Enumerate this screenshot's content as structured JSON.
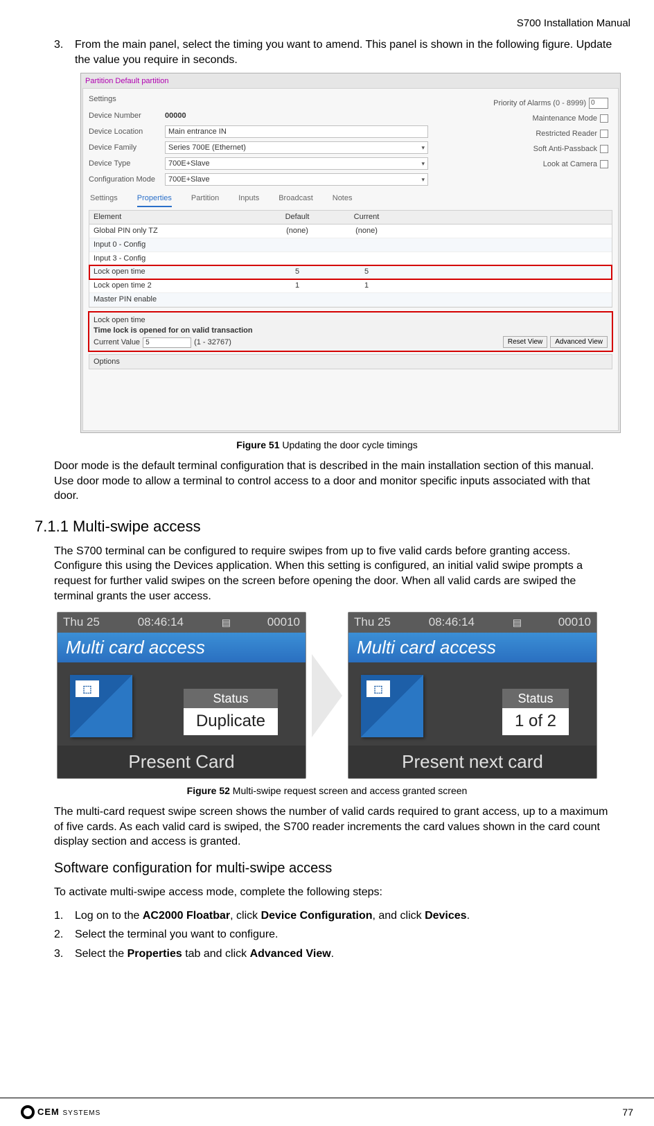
{
  "header": {
    "doc_title": "S700 Installation Manual"
  },
  "step3_text": "From the main panel, select the timing you want to amend. This panel is shown in the following figure. Update the value you require in seconds.",
  "fig51": {
    "window_title": "Partition  Default partition",
    "group_label": "Settings",
    "rows": {
      "device_number_lbl": "Device Number",
      "device_number_val": "00000",
      "device_location_lbl": "Device Location",
      "device_location_val": "Main entrance IN",
      "device_family_lbl": "Device Family",
      "device_family_val": "Series 700E (Ethernet)",
      "device_type_lbl": "Device Type",
      "device_type_val": "700E+Slave",
      "config_mode_lbl": "Configuration Mode",
      "config_mode_val": "700E+Slave"
    },
    "right": {
      "priority_lbl": "Priority of Alarms (0 - 8999)",
      "priority_val": "0",
      "maint_lbl": "Maintenance Mode",
      "restricted_lbl": "Restricted Reader",
      "soft_apb_lbl": "Soft Anti-Passback",
      "look_cam_lbl": "Look at Camera"
    },
    "tabs": [
      "Settings",
      "Properties",
      "Partition",
      "Inputs",
      "Broadcast",
      "Notes"
    ],
    "grid": {
      "head": [
        "Element",
        "Default",
        "Current"
      ],
      "rows": [
        {
          "e": "Global PIN only TZ",
          "d": "(none)",
          "c": "(none)",
          "alt": false
        },
        {
          "e": "Input 0 - Config",
          "d": "",
          "c": "",
          "alt": true
        },
        {
          "e": "Input 3 - Config",
          "d": "",
          "c": "",
          "alt": false
        },
        {
          "e": "Lock open time",
          "d": "5",
          "c": "5",
          "alt": true,
          "hl": true
        },
        {
          "e": "Lock open time 2",
          "d": "1",
          "c": "1",
          "alt": false
        },
        {
          "e": "Master PIN enable",
          "d": "",
          "c": "",
          "alt": true
        }
      ]
    },
    "detail": {
      "title": "Lock open time",
      "desc": "Time lock is opened for on valid transaction",
      "current_lbl": "Current Value",
      "current_val": "5",
      "range": "(1 - 32767)"
    },
    "btn_reset": "Reset View",
    "btn_adv": "Advanced View",
    "options_lbl": "Options",
    "caption_b": "Figure 51",
    "caption_t": " Updating the door cycle timings"
  },
  "door_mode_para": "Door mode is the default terminal configuration that is described in the main installation section of this manual. Use door mode to allow a terminal to control access to a door and monitor specific inputs associated with that door.",
  "h_711": "7.1.1  Multi-swipe access",
  "multiswipe_intro": "The S700 terminal can be configured to require swipes from up to five valid cards before granting access. Configure this using the Devices application. When this setting is configured, an initial valid swipe prompts a request for further valid swipes on the screen before opening the door. When all valid cards are swiped the terminal grants the user access.",
  "fig52": {
    "left": {
      "date": "Thu 25",
      "time": "08:46:14",
      "id": "00010",
      "blue": "Multi card access",
      "status_top": "Status",
      "status_bot": "Duplicate",
      "foot": "Present Card"
    },
    "right": {
      "date": "Thu 25",
      "time": "08:46:14",
      "id": "00010",
      "blue": "Multi card access",
      "status_top": "Status",
      "status_bot": "1 of 2",
      "foot": "Present next card"
    },
    "caption_b": "Figure 52",
    "caption_t": " Multi-swipe request screen and access granted screen"
  },
  "multiswipe_para2": "The multi-card request swipe screen shows the number of valid cards required to grant access, up to a maximum of five cards. As each valid card is swiped, the S700 reader increments the card values shown in the card count display section and access is granted.",
  "h_sw_cfg": "Software configuration for multi-swipe access",
  "sw_cfg_intro": "To activate multi-swipe access mode, complete the following steps:",
  "steps": {
    "1_pre": "Log on to the ",
    "1_b1": "AC2000 Floatbar",
    "1_mid1": ", click ",
    "1_b2": "Device Configuration",
    "1_mid2": ", and click ",
    "1_b3": "Devices",
    "1_post": ".",
    "2": "Select the terminal you want to configure.",
    "3_pre": "Select the ",
    "3_b1": "Properties",
    "3_mid": " tab and click ",
    "3_b2": "Advanced View",
    "3_post": "."
  },
  "footer": {
    "logo_text": "CEM",
    "logo_sub": "SYSTEMS",
    "page": "77"
  }
}
